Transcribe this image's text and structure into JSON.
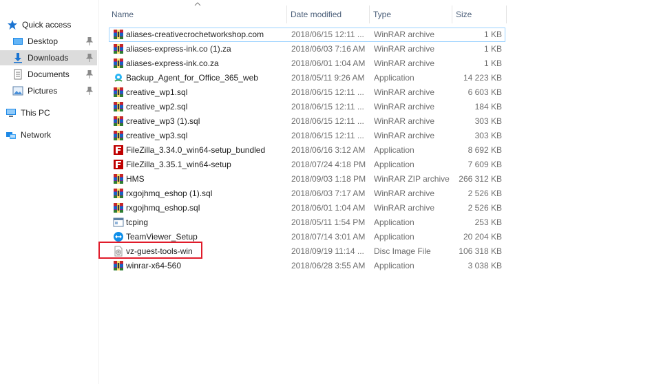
{
  "nav": {
    "items": [
      {
        "label": "Quick access",
        "icon": "star-icon"
      },
      {
        "label": "Desktop",
        "icon": "desktop-icon"
      },
      {
        "label": "Downloads",
        "icon": "downloads-icon"
      },
      {
        "label": "Documents",
        "icon": "documents-icon"
      },
      {
        "label": "Pictures",
        "icon": "pictures-icon"
      },
      {
        "label": "This PC",
        "icon": "computer-icon"
      },
      {
        "label": "Network",
        "icon": "network-icon"
      }
    ]
  },
  "columns": {
    "name": "Name",
    "date": "Date modified",
    "type": "Type",
    "size": "Size"
  },
  "files": [
    {
      "name": "aliases-creativecrochetworkshop.com",
      "date": "2018/06/15 12:11 ...",
      "type": "WinRAR archive",
      "size": "1 KB",
      "icon": "winrar"
    },
    {
      "name": "aliases-express-ink.co (1).za",
      "date": "2018/06/03 7:16 AM",
      "type": "WinRAR archive",
      "size": "1 KB",
      "icon": "winrar"
    },
    {
      "name": "aliases-express-ink.co.za",
      "date": "2018/06/01 1:04 AM",
      "type": "WinRAR archive",
      "size": "1 KB",
      "icon": "winrar"
    },
    {
      "name": "Backup_Agent_for_Office_365_web",
      "date": "2018/05/11 9:26 AM",
      "type": "Application",
      "size": "14 223 KB",
      "icon": "installer"
    },
    {
      "name": "creative_wp1.sql",
      "date": "2018/06/15 12:11 ...",
      "type": "WinRAR archive",
      "size": "6 603 KB",
      "icon": "winrar"
    },
    {
      "name": "creative_wp2.sql",
      "date": "2018/06/15 12:11 ...",
      "type": "WinRAR archive",
      "size": "184 KB",
      "icon": "winrar"
    },
    {
      "name": "creative_wp3 (1).sql",
      "date": "2018/06/15 12:11 ...",
      "type": "WinRAR archive",
      "size": "303 KB",
      "icon": "winrar"
    },
    {
      "name": "creative_wp3.sql",
      "date": "2018/06/15 12:11 ...",
      "type": "WinRAR archive",
      "size": "303 KB",
      "icon": "winrar"
    },
    {
      "name": "FileZilla_3.34.0_win64-setup_bundled",
      "date": "2018/06/16 3:12 AM",
      "type": "Application",
      "size": "8 692 KB",
      "icon": "filezilla"
    },
    {
      "name": "FileZilla_3.35.1_win64-setup",
      "date": "2018/07/24 4:18 PM",
      "type": "Application",
      "size": "7 609 KB",
      "icon": "filezilla"
    },
    {
      "name": "HMS",
      "date": "2018/09/03 1:18 PM",
      "type": "WinRAR ZIP archive",
      "size": "266 312 KB",
      "icon": "winrar"
    },
    {
      "name": "rxgojhmq_eshop (1).sql",
      "date": "2018/06/03 7:17 AM",
      "type": "WinRAR archive",
      "size": "2 526 KB",
      "icon": "winrar"
    },
    {
      "name": "rxgojhmq_eshop.sql",
      "date": "2018/06/01 1:04 AM",
      "type": "WinRAR archive",
      "size": "2 526 KB",
      "icon": "winrar"
    },
    {
      "name": "tcping",
      "date": "2018/05/11 1:54 PM",
      "type": "Application",
      "size": "253 KB",
      "icon": "app"
    },
    {
      "name": "TeamViewer_Setup",
      "date": "2018/07/14 3:01 AM",
      "type": "Application",
      "size": "20 204 KB",
      "icon": "teamviewer"
    },
    {
      "name": "vz-guest-tools-win",
      "date": "2018/09/19 11:14 ...",
      "type": "Disc Image File",
      "size": "106 318 KB",
      "icon": "disc"
    },
    {
      "name": "winrar-x64-560",
      "date": "2018/06/28 3:55 AM",
      "type": "Application",
      "size": "3 038 KB",
      "icon": "winrar"
    }
  ],
  "colors": {
    "accent": "#0078d7",
    "highlight": "#e01b2a",
    "header_text": "#4c607a",
    "selected_nav": "#dcdcdc"
  }
}
